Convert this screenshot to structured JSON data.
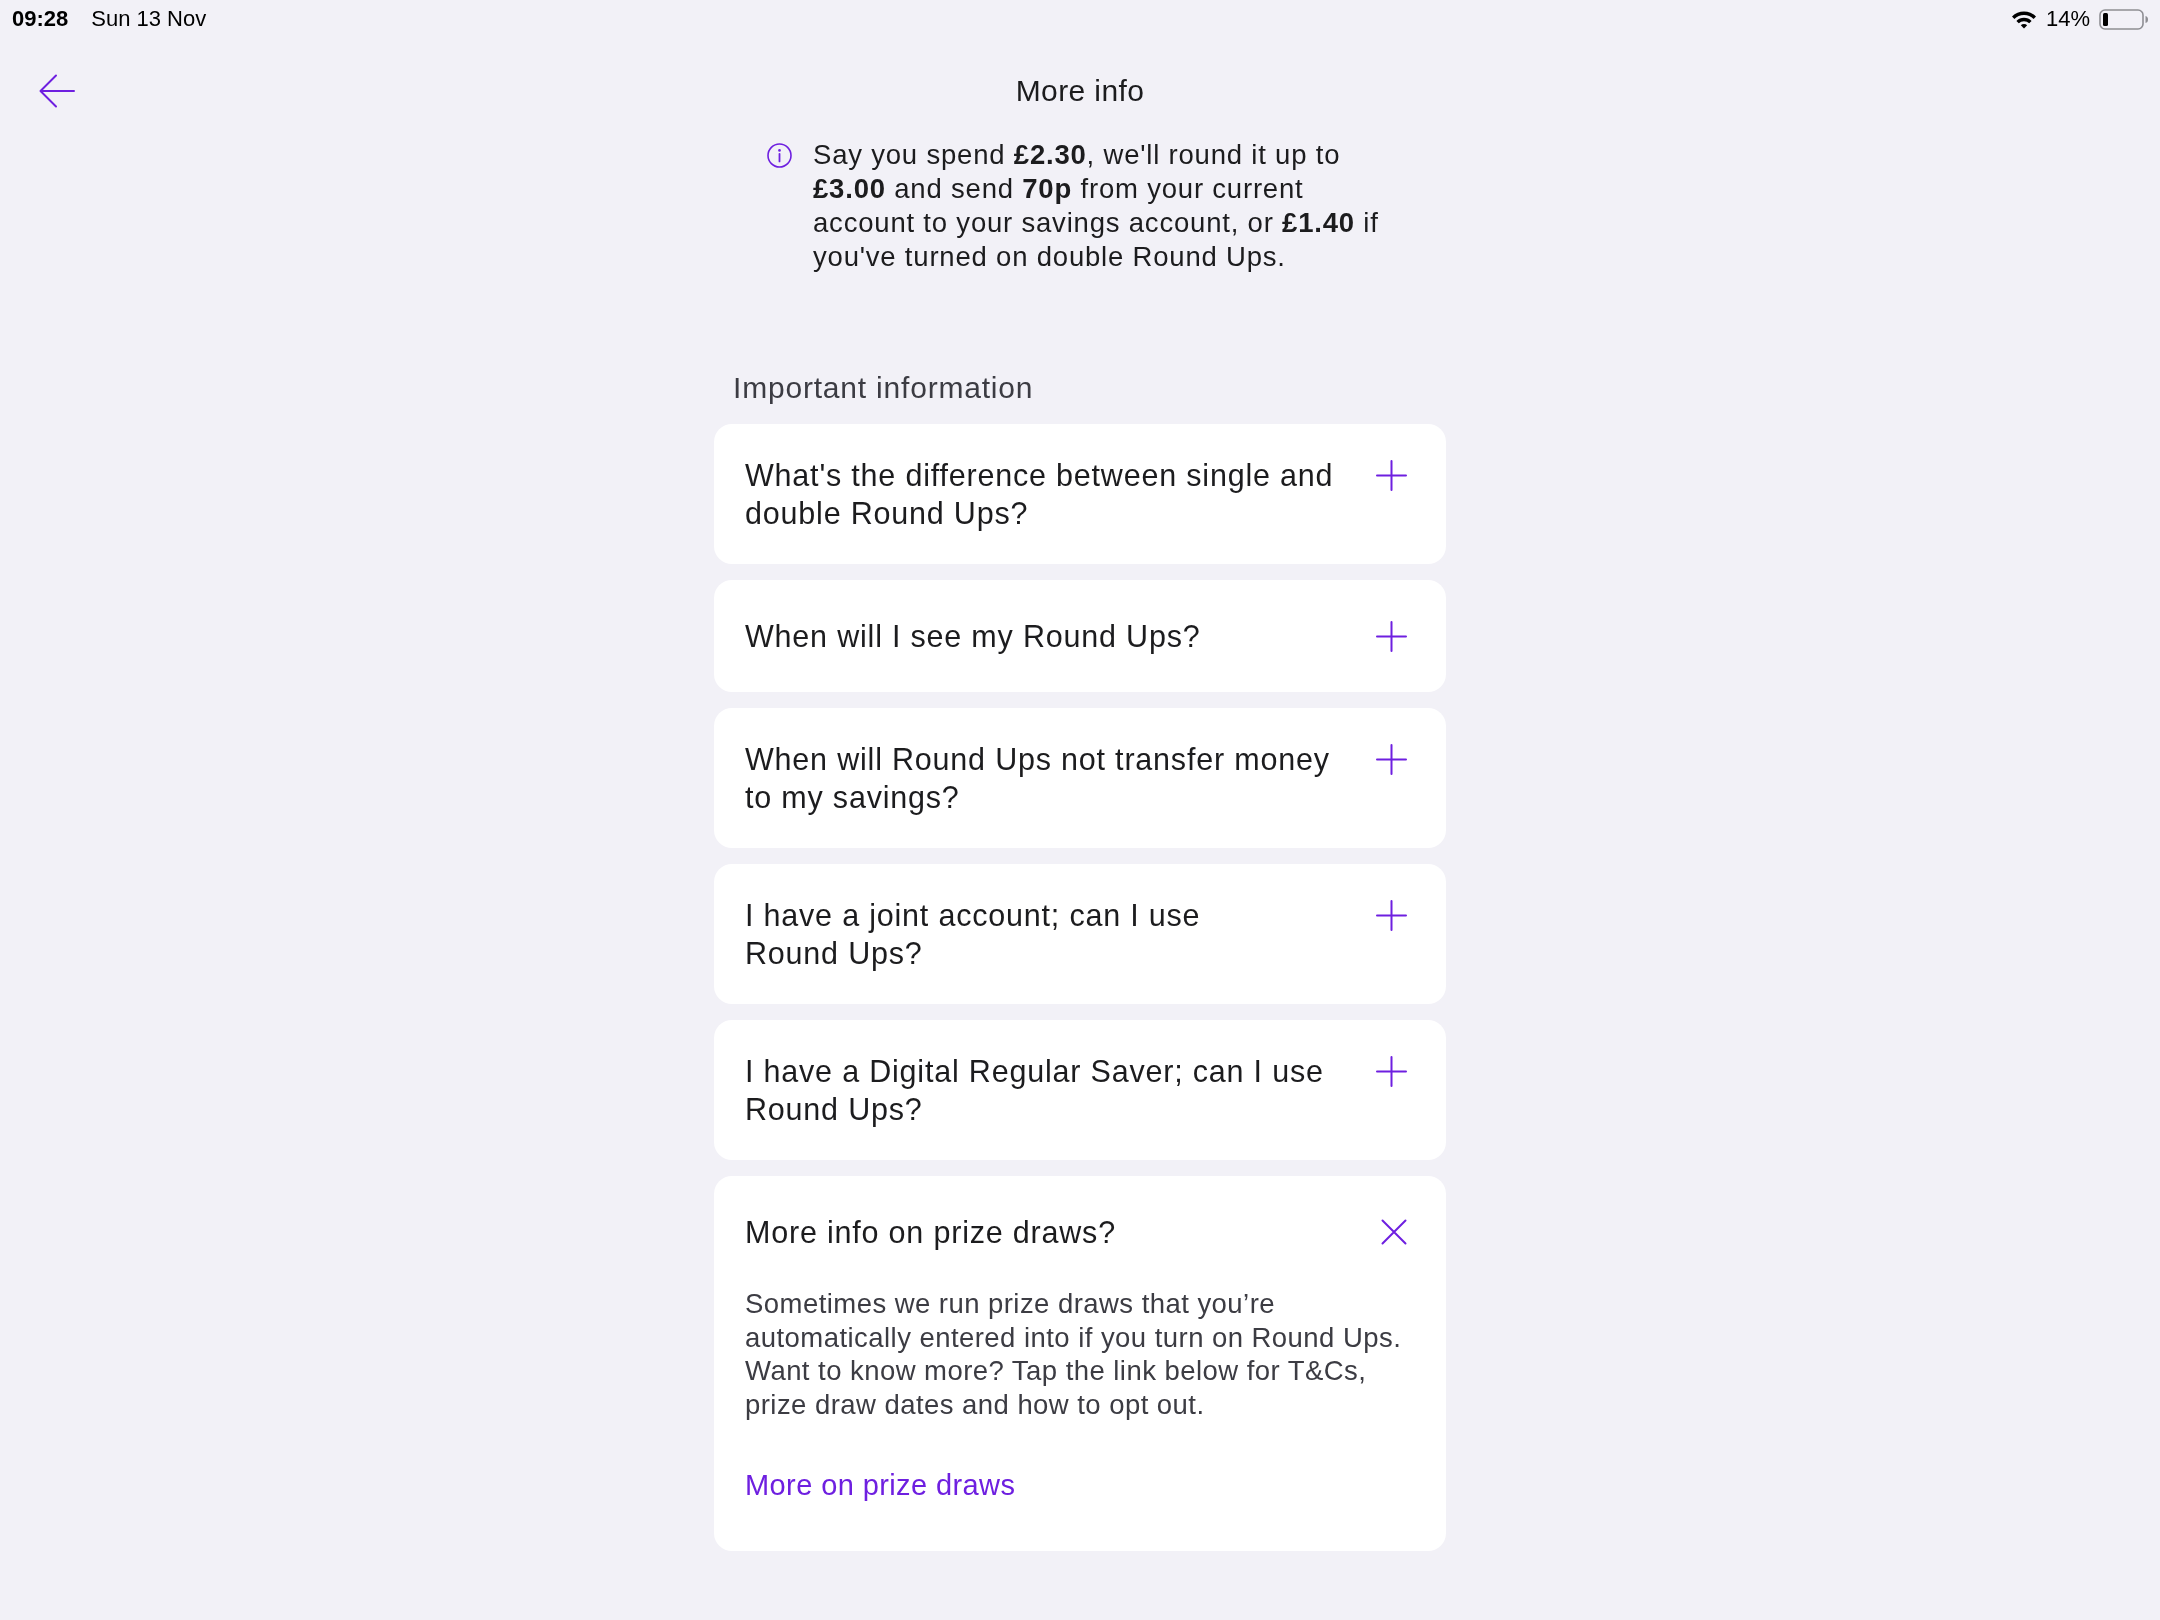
{
  "status_bar": {
    "time": "09:28",
    "date": "Sun 13 Nov",
    "battery": "14%"
  },
  "header": {
    "title": "More info"
  },
  "info_note": {
    "text": "Say you spend **£2.30**, we'll round it up to **£3.00** and send **70p** from your current account to your savings account, or **£1.40** if you've turned on double Round Ups."
  },
  "section": {
    "heading": "Important information",
    "items": [
      {
        "question": "What's the difference between single and double Round Ups?",
        "expanded": false
      },
      {
        "question": "When will I see my Round Ups?",
        "expanded": false
      },
      {
        "question": "When will Round Ups not transfer money to my savings?",
        "expanded": false
      },
      {
        "question": "I have a joint account; can I use Round Ups?",
        "expanded": false
      },
      {
        "question": "I have a Digital Regular Saver; can I use Round Ups?",
        "expanded": false
      },
      {
        "question": "More info on prize draws?",
        "expanded": true,
        "answer": "Sometimes we run prize draws that you’re automatically entered into if you turn on Round Ups. Want to know more? Tap the link below for T&Cs, prize draw dates and how to opt out.",
        "link": "More on prize draws"
      }
    ]
  }
}
